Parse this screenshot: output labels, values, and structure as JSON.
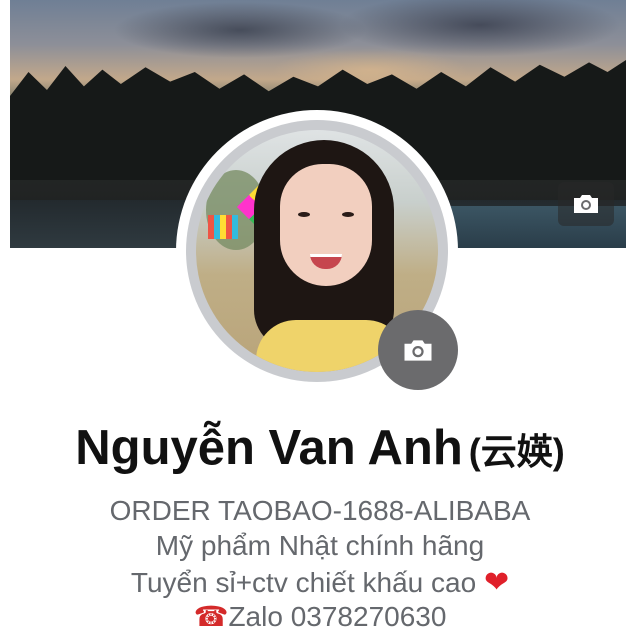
{
  "profile": {
    "name": "Nguyễn Van Anh",
    "alt_name": "(云媖)",
    "bio": [
      "ORDER TAOBAO-1688-ALIBABA",
      "Mỹ phẩm Nhật chính hãng",
      "Tuyển sỉ+ctv chiết khấu cao",
      "Zalo 0378270630"
    ]
  },
  "icons": {
    "cover_camera": "camera-icon",
    "avatar_camera": "camera-icon",
    "heart": "❤",
    "phone": "☎"
  },
  "colors": {
    "name": "#111111",
    "bio": "#65686d",
    "camera_badge": "#6b6b6d",
    "heart": "#e0202a"
  }
}
